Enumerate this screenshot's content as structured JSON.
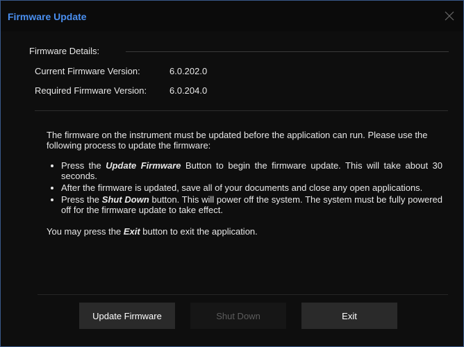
{
  "window": {
    "title": "Firmware Update"
  },
  "details": {
    "heading": "Firmware Details:",
    "current_label": "Current Firmware Version:",
    "current_value": "6.0.202.0",
    "required_label": "Required Firmware Version:",
    "required_value": "6.0.204.0"
  },
  "message": {
    "intro": "The firmware on the instrument must be updated before the application can run. Please use the following process to update the firmware:",
    "steps": [
      {
        "before": "Press the ",
        "keyword": "Update Firmware",
        "after": " Button to begin the firmware update.  This will take about 30 seconds."
      },
      {
        "text": "After the firmware is updated, save all of your documents and close any open applications."
      },
      {
        "before": "Press the ",
        "keyword": "Shut Down",
        "after": " button.  This will power off the system.  The system must be fully powered off for the firmware update to take effect."
      }
    ],
    "exit_before": "You may press the ",
    "exit_keyword": "Exit",
    "exit_after": " button to exit the application."
  },
  "buttons": {
    "update_label": "Update Firmware",
    "shutdown_label": "Shut Down",
    "exit_label": "Exit"
  },
  "colors": {
    "title": "#4a8ff0",
    "border": "#3a5a8c",
    "background": "#0e0e0e",
    "button": "#2a2a2a",
    "button_disabled_text": "#5c5c5c"
  },
  "icons": {
    "close": "close-icon"
  }
}
